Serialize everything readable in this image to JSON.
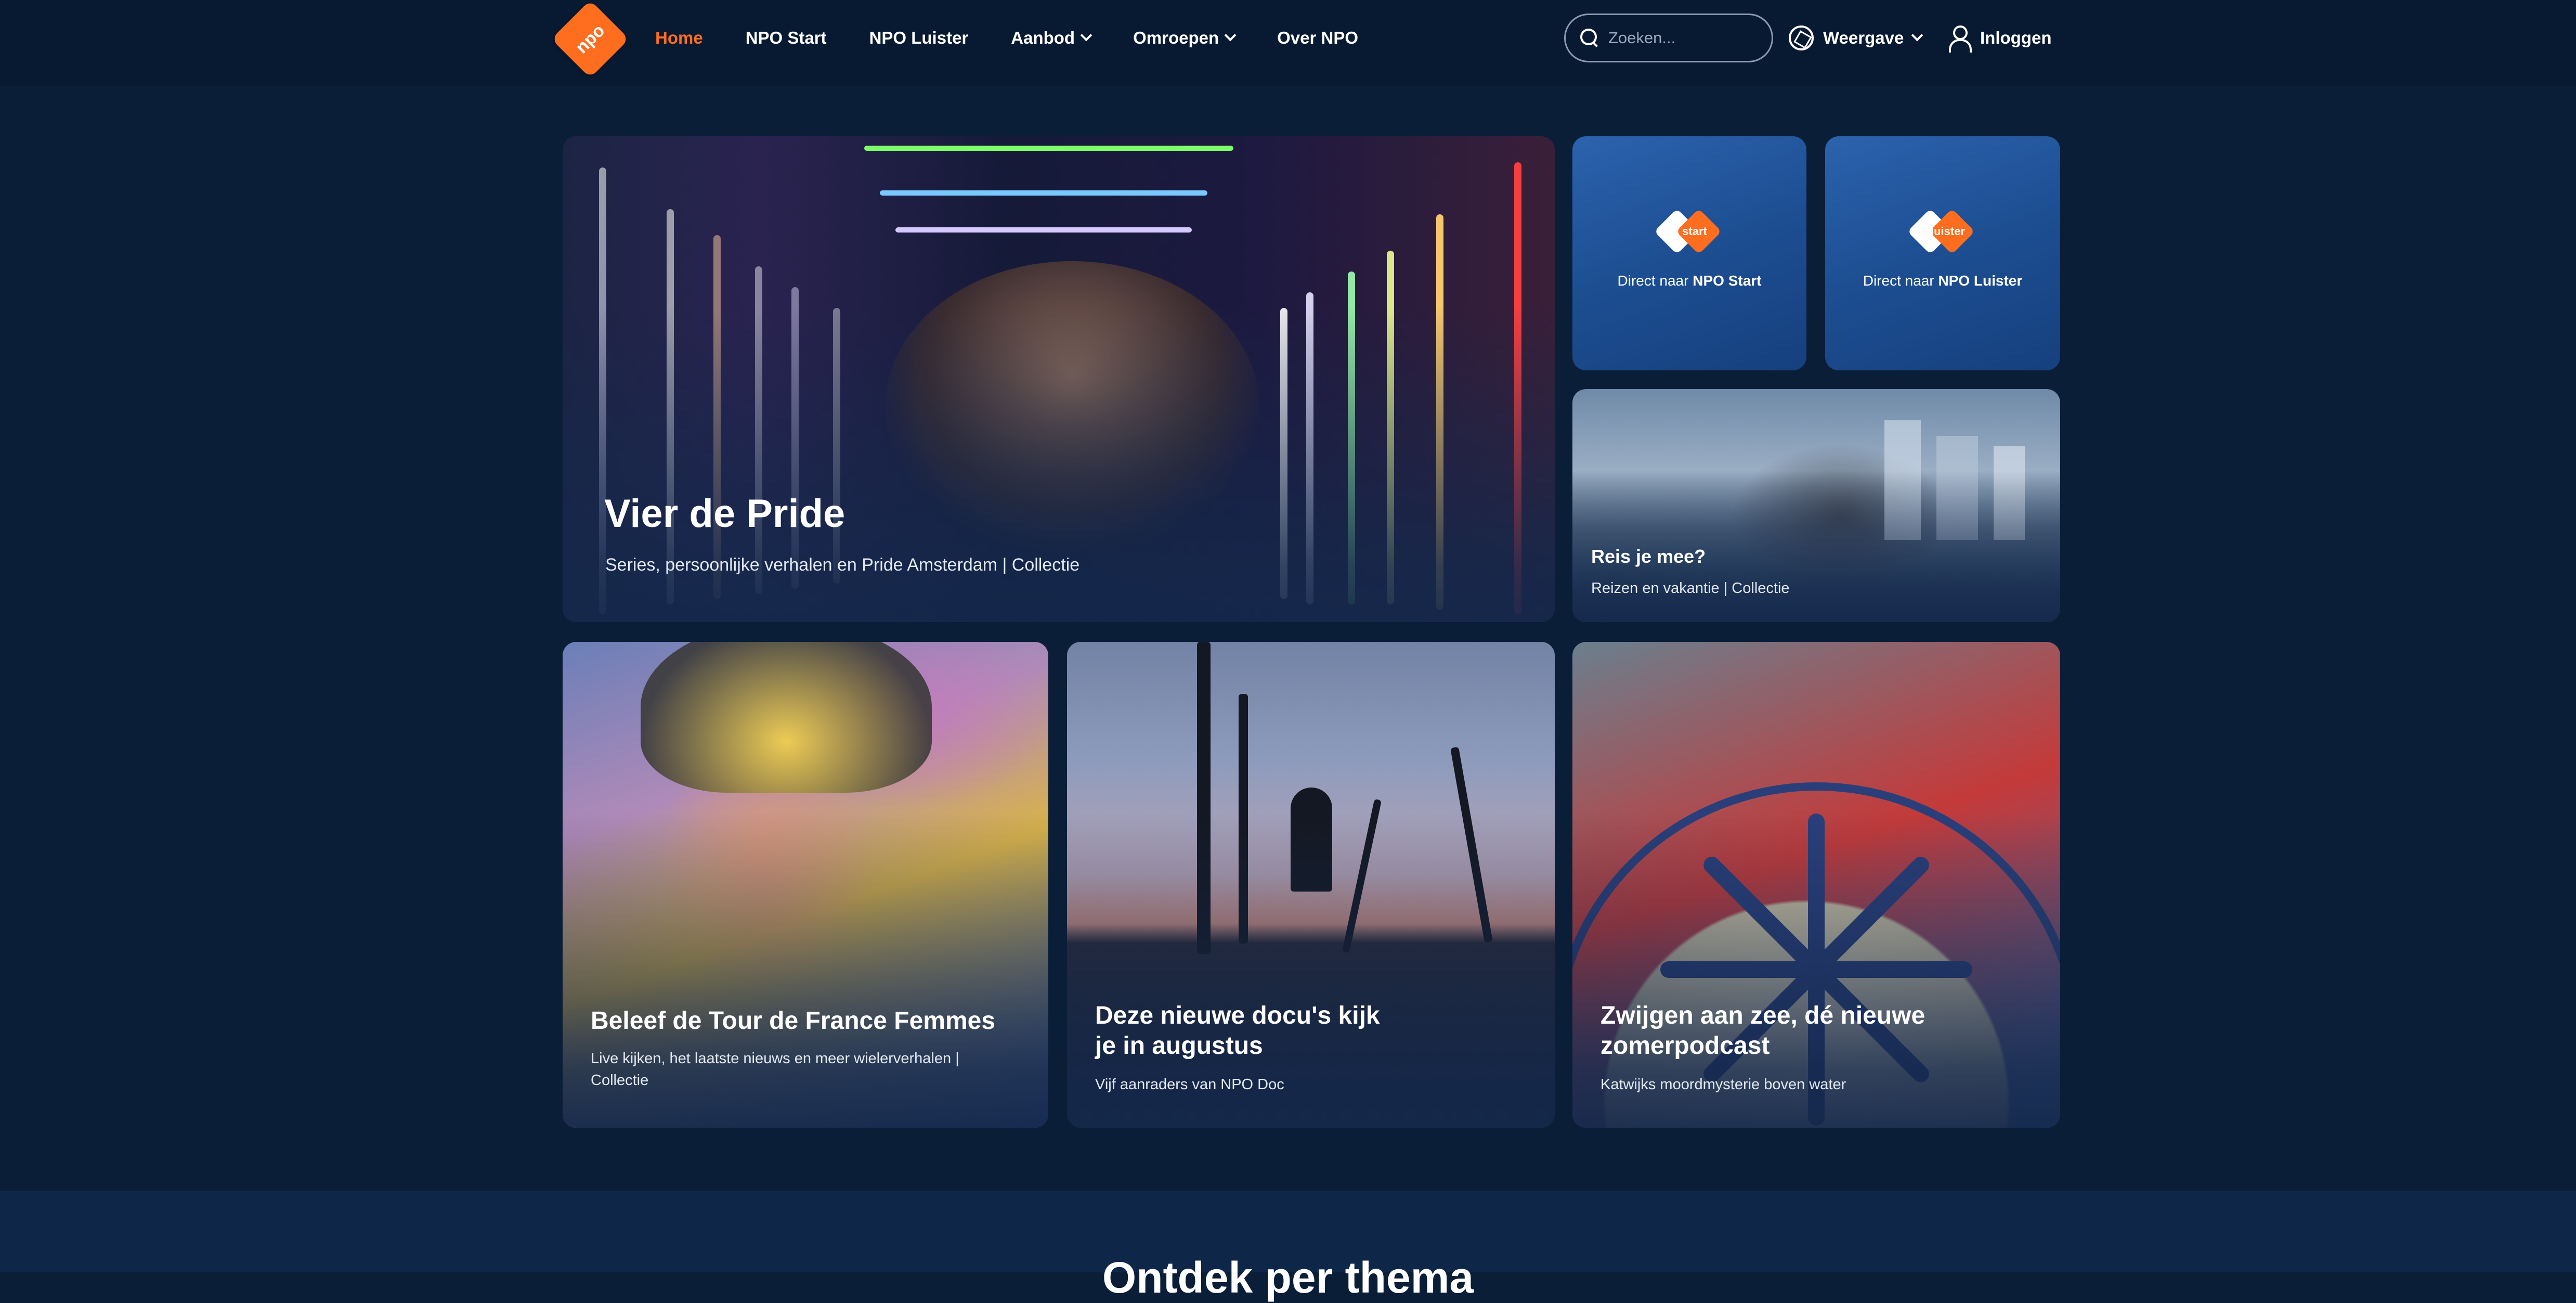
{
  "header": {
    "logo_text": "npo",
    "nav": [
      {
        "label": "Home",
        "active": true
      },
      {
        "label": "NPO Start"
      },
      {
        "label": "NPO Luister"
      },
      {
        "label": "Aanbod",
        "dropdown": true
      },
      {
        "label": "Omroepen",
        "dropdown": true
      },
      {
        "label": "Over NPO"
      }
    ],
    "search_placeholder": "Zoeken...",
    "display_label": "Weergave",
    "login_label": "Inloggen"
  },
  "hero": {
    "title": "Vier de Pride",
    "subtitle": "Series, persoonlijke verhalen en Pride Amsterdam | Collectie"
  },
  "tiles": [
    {
      "badge": "start",
      "prefix": "Direct naar ",
      "brand": "NPO Start"
    },
    {
      "badge": "luister",
      "prefix": "Direct naar ",
      "brand": "NPO Luister"
    }
  ],
  "cards": {
    "reis": {
      "title": "Reis je mee?",
      "subtitle": "Reizen en vakantie | Collectie"
    },
    "tour": {
      "title": "Beleef de Tour de France Femmes",
      "subtitle": "Live kijken, het laatste nieuws en meer wielerverhalen | Collectie"
    },
    "docu": {
      "title": "Deze nieuwe docu's kijk je in augustus",
      "subtitle": "Vijf aanraders van NPO Doc"
    },
    "zee": {
      "title": "Zwijgen aan zee, dé nieuwe zomerpodcast",
      "subtitle": "Katwijks moordmysterie boven water"
    }
  },
  "section": {
    "title": "Ontdek per thema"
  },
  "icons": {
    "search": "search-icon",
    "display": "aperture-icon",
    "login": "user-icon",
    "chevron": "chevron-down-icon"
  },
  "colors": {
    "accent": "#ff6d1f",
    "background": "#0b1e38",
    "header": "#081a32",
    "tile": "#2160a8"
  }
}
